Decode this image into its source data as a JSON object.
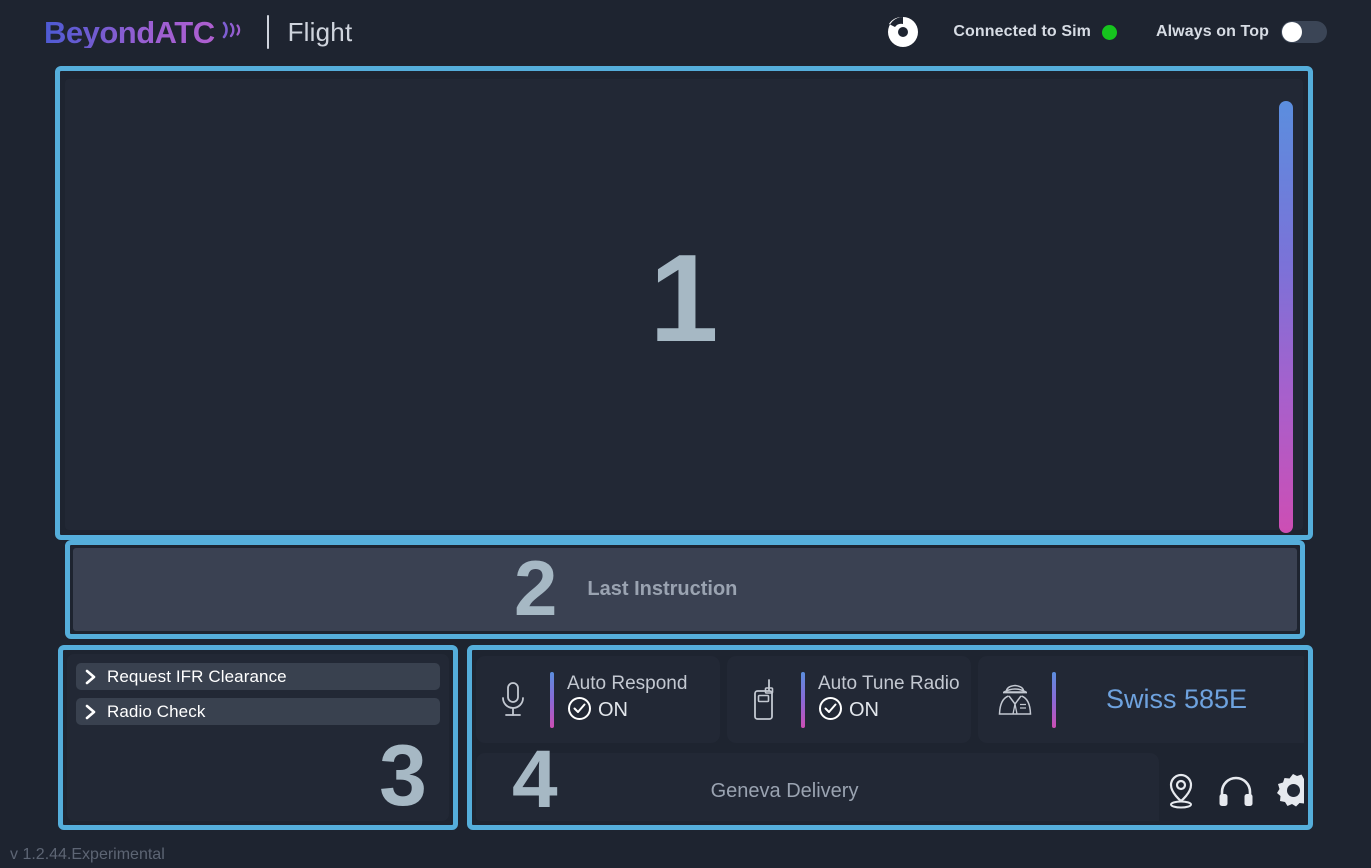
{
  "app": {
    "brand": "BeyondATC",
    "brand_icon": "sound-waves-icon",
    "page_title": "Flight",
    "version": "v 1.2.44.Experimental",
    "accent_blue": "#55aedb",
    "accent_purple": "#8a5fd0",
    "status_green": "#16c41e"
  },
  "topbar": {
    "app_icon": "beyondatc-app-icon",
    "sim_status_label": "Connected to Sim",
    "sim_status_connected": true,
    "always_on_top_label": "Always on Top",
    "always_on_top_enabled": false
  },
  "panel_1": {
    "number": "1",
    "scrollbar": "vertical-scrollbar"
  },
  "panel_2": {
    "number": "2",
    "label": "Last Instruction"
  },
  "panel_3": {
    "number": "3",
    "menu_items": [
      {
        "label": "Request IFR Clearance",
        "icon": "chevron-right-icon"
      },
      {
        "label": "Radio Check",
        "icon": "chevron-right-icon"
      }
    ]
  },
  "panel_4": {
    "number": "4",
    "station": "Geneva Delivery",
    "callsign": "Swiss 585E",
    "callsign_icon": "pilot-icon",
    "status_cards": [
      {
        "title": "Auto Respond",
        "value": "ON",
        "icon": "microphone-icon",
        "state_icon": "check-circle-icon"
      },
      {
        "title": "Auto Tune Radio",
        "value": "ON",
        "icon": "walkie-talkie-icon",
        "state_icon": "check-circle-icon"
      }
    ],
    "action_icons": [
      {
        "name": "map-pin-icon",
        "label": "Map"
      },
      {
        "name": "headset-icon",
        "label": "Audio"
      },
      {
        "name": "gear-icon",
        "label": "Settings"
      }
    ]
  }
}
